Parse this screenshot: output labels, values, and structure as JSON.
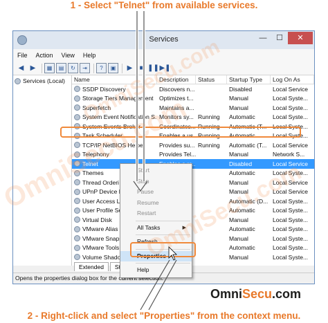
{
  "captions": {
    "top": "1 - Select  \"Telnet\" from available services.",
    "bottom": "2 - Right-click and select \"Properties\" from the context menu."
  },
  "window": {
    "title": "Services",
    "controls": {
      "minimize": "—",
      "maximize": "☐",
      "close": "✕"
    }
  },
  "menubar": [
    "File",
    "Action",
    "View",
    "Help"
  ],
  "tree": {
    "root": "Services (Local)"
  },
  "columns": [
    "Name",
    "Description",
    "Status",
    "Startup Type",
    "Log On As"
  ],
  "services": [
    {
      "name": "SSDP Discovery",
      "desc": "Discovers n...",
      "status": "",
      "startup": "Disabled",
      "logon": "Local Service"
    },
    {
      "name": "Storage Tiers Management",
      "desc": "Optimizes t...",
      "status": "",
      "startup": "Manual",
      "logon": "Local Syste..."
    },
    {
      "name": "Superfetch",
      "desc": "Maintains a...",
      "status": "",
      "startup": "Manual",
      "logon": "Local Syste..."
    },
    {
      "name": "System Event Notification S...",
      "desc": "Monitors sy...",
      "status": "Running",
      "startup": "Automatic",
      "logon": "Local Syste..."
    },
    {
      "name": "System Events Broker",
      "desc": "Coordinates...",
      "status": "Running",
      "startup": "Automatic (T...",
      "logon": "Local Syste..."
    },
    {
      "name": "Task Scheduler",
      "desc": "Enables a us...",
      "status": "Running",
      "startup": "Automatic",
      "logon": "Local Syste..."
    },
    {
      "name": "TCP/IP NetBIOS Helper",
      "desc": "Provides su...",
      "status": "Running",
      "startup": "Automatic (T...",
      "logon": "Local Service"
    },
    {
      "name": "Telephony",
      "desc": "Provides Tel...",
      "status": "",
      "startup": "Manual",
      "logon": "Network S..."
    },
    {
      "name": "Telnet",
      "desc": "Enables a re...",
      "status": "",
      "startup": "Disabled",
      "logon": "Local Service"
    },
    {
      "name": "Themes",
      "desc": "",
      "status": "",
      "startup": "Automatic",
      "logon": "Local Syste..."
    },
    {
      "name": "Thread Orderi",
      "desc": "",
      "status": "",
      "startup": "Manual",
      "logon": "Local Service"
    },
    {
      "name": "UPnP Device H",
      "desc": "",
      "status": "",
      "startup": "Manual",
      "logon": "Local Service"
    },
    {
      "name": "User Access L",
      "desc": "",
      "status": "",
      "startup": "Automatic (D...",
      "logon": "Local Syste..."
    },
    {
      "name": "User Profile Se",
      "desc": "",
      "status": "",
      "startup": "Automatic",
      "logon": "Local Syste..."
    },
    {
      "name": "Virtual Disk",
      "desc": "",
      "status": "",
      "startup": "Manual",
      "logon": "Local Syste..."
    },
    {
      "name": "VMware Alias",
      "desc": "",
      "status": "",
      "startup": "Automatic",
      "logon": "Local Syste..."
    },
    {
      "name": "VMware Snaps",
      "desc": "",
      "status": "",
      "startup": "Manual",
      "logon": "Local Syste..."
    },
    {
      "name": "VMware Tools",
      "desc": "",
      "status": "",
      "startup": "Automatic",
      "logon": "Local Syste..."
    },
    {
      "name": "Volume Shado",
      "desc": "",
      "status": "",
      "startup": "Manual",
      "logon": "Local Syste..."
    }
  ],
  "context_menu": {
    "start": "Start",
    "stop": "Stop",
    "pause": "Pause",
    "resume": "Resume",
    "restart": "Restart",
    "all_tasks": "All Tasks",
    "refresh": "Refresh",
    "properties": "Properties",
    "help": "Help"
  },
  "tabs": [
    "Extended",
    "Stan"
  ],
  "statusbar": "Opens the properties dialog box for the current selection.",
  "watermark": "OmniSecu.com",
  "logo": {
    "part1": "Omni",
    "part2": "Secu",
    "part3": ".com"
  },
  "colors": {
    "accent": "#e8792a",
    "selection": "#3399ff"
  }
}
